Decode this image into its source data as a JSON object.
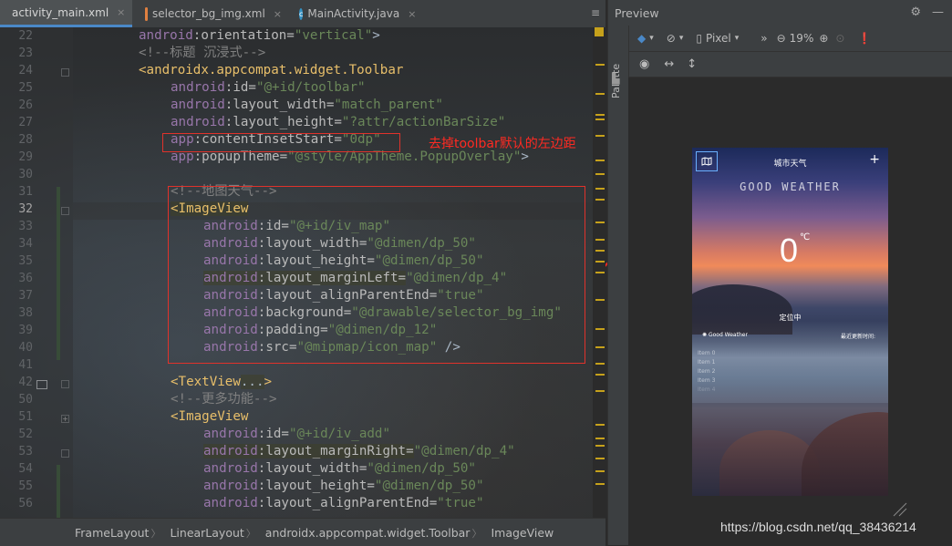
{
  "tabs": [
    {
      "name": "activity_main.xml",
      "kind": "xml",
      "active": true
    },
    {
      "name": "selector_bg_img.xml",
      "kind": "xml",
      "active": false
    },
    {
      "name": "MainActivity.java",
      "kind": "class",
      "active": false
    }
  ],
  "tab_close": "×",
  "tab_overflow": "≡",
  "line_numbers": [
    "22",
    "23",
    "24",
    "25",
    "26",
    "27",
    "28",
    "29",
    "30",
    "31",
    "32",
    "33",
    "34",
    "35",
    "36",
    "37",
    "38",
    "39",
    "40",
    "41",
    "42",
    "50",
    "51",
    "52",
    "53",
    "54",
    "55",
    "56"
  ],
  "current_line": "32",
  "code": {
    "l22": {
      "ns": "android",
      "attr": ":orientation=",
      "val": "\"vertical\"",
      "tail": ">"
    },
    "l23": {
      "com": "<!--标题 沉浸式-->"
    },
    "l24": {
      "tag": "<androidx.appcompat.widget.Toolbar"
    },
    "l25": {
      "ns": "android",
      "attr": ":id=",
      "val": "\"@+id/toolbar\""
    },
    "l26": {
      "ns": "android",
      "attr": ":layout_width=",
      "val": "\"match_parent\""
    },
    "l27": {
      "ns": "android",
      "attr": ":layout_height=",
      "val": "\"?attr/actionBarSize\""
    },
    "l28": {
      "ns": "app",
      "attr": ":contentInsetStart=",
      "val": "\"0dp\""
    },
    "l29": {
      "ns": "app",
      "attr": ":popupTheme=",
      "val": "\"@style/AppTheme.PopupOverlay\"",
      "tail": ">"
    },
    "l31": {
      "com": "<!--地图天气-->"
    },
    "l32": {
      "tag": "<ImageView"
    },
    "l33": {
      "ns": "android",
      "attr": ":id=",
      "val": "\"@+id/iv_map\""
    },
    "l34": {
      "ns": "android",
      "attr": ":layout_width=",
      "val": "\"@dimen/dp_50\""
    },
    "l35": {
      "ns": "android",
      "attr": ":layout_height=",
      "val": "\"@dimen/dp_50\""
    },
    "l36": {
      "ns": "android",
      "attr": ":layout_marginLeft=",
      "val": "\"@dimen/dp_4\""
    },
    "l37": {
      "ns": "android",
      "attr": ":layout_alignParentEnd=",
      "val": "\"true\""
    },
    "l38": {
      "ns": "android",
      "attr": ":background=",
      "val": "\"@drawable/selector_bg_img\""
    },
    "l39": {
      "ns": "android",
      "attr": ":padding=",
      "val": "\"@dimen/dp_12\""
    },
    "l40": {
      "ns": "android",
      "attr": ":src=",
      "val": "\"@mipmap/icon_map\"",
      "tail": " />"
    },
    "l42": {
      "tag": "<TextView",
      "dots": "...",
      "tail": ">"
    },
    "l50": {
      "com": "<!--更多功能-->"
    },
    "l51": {
      "tag": "<ImageView"
    },
    "l52": {
      "ns": "android",
      "attr": ":id=",
      "val": "\"@+id/iv_add\""
    },
    "l53": {
      "ns": "android",
      "attr": ":layout_marginRight=",
      "val": "\"@dimen/dp_4\""
    },
    "l54": {
      "ns": "android",
      "attr": ":layout_width=",
      "val": "\"@dimen/dp_50\""
    },
    "l55": {
      "ns": "android",
      "attr": ":layout_height=",
      "val": "\"@dimen/dp_50\""
    },
    "l56": {
      "ns": "android",
      "attr": ":layout_alignParentEnd=",
      "val": "\"true\""
    }
  },
  "annotation": "去掉toolbar默认的左边距",
  "breadcrumbs": [
    "FrameLayout",
    "LinearLayout",
    "androidx.appcompat.widget.Toolbar",
    "ImageView"
  ],
  "preview": {
    "title": "Preview",
    "palette_label": "Palette",
    "device": "Pixel",
    "zoom": "19%",
    "more": "»"
  },
  "phone": {
    "title": "城市天气",
    "add_symbol": "+",
    "good_weather_banner": "GOOD WEATHER",
    "temperature": "0",
    "unit": "℃",
    "location": "定位中",
    "good_weather": "Good Weather",
    "last_update": "最近更新时间:",
    "items": [
      "Item 0",
      "Item 1",
      "Item 2",
      "Item 3",
      "Item 4"
    ]
  },
  "watermark": "https://blog.csdn.net/qq_38436214",
  "colors": {
    "accent": "#4a88c7",
    "annotation_red": "#ff2a22",
    "xml_tag": "#e8bf6a",
    "xml_value": "#6a8759",
    "xml_namespace": "#9876aa"
  }
}
